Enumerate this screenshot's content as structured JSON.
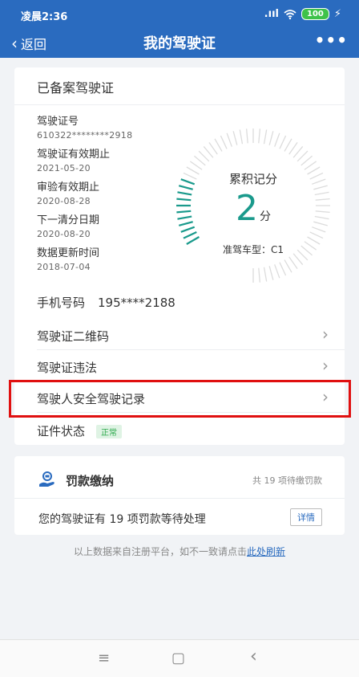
{
  "status_bar": {
    "time": "凌晨2:36",
    "signal": ".ııl",
    "wifi": "wifi-icon",
    "battery": "100",
    "charging": "⚡"
  },
  "nav": {
    "back_label": "返回",
    "title": "我的驾驶证",
    "more": "•••"
  },
  "license_card": {
    "title": "已备案驾驶证",
    "fields": [
      {
        "label": "驾驶证号",
        "value": "610322********2918"
      },
      {
        "label": "驾驶证有效期止",
        "value": "2021-05-20"
      },
      {
        "label": "审验有效期止",
        "value": "2020-08-28"
      },
      {
        "label": "下一清分日期",
        "value": "2020-08-20"
      },
      {
        "label": "数据更新时间",
        "value": "2018-07-04"
      }
    ],
    "gauge": {
      "label": "累积记分",
      "score": "2",
      "unit": "分",
      "max": 12,
      "vehicle_type": "准驾车型：C1"
    },
    "phone": {
      "label": "手机号码",
      "value": "195****2188"
    },
    "rows": [
      {
        "label": "驾驶证二维码"
      },
      {
        "label": "驾驶证违法"
      },
      {
        "label": "驾驶人安全驾驶记录"
      }
    ],
    "status": {
      "label": "证件状态",
      "badge": "正常"
    }
  },
  "fine_card": {
    "title": "罚款缴纳",
    "count_text": "共 19 项待缴罚款",
    "message": "您的驾驶证有 19 项罚款等待处理",
    "detail_button": "详情"
  },
  "footer": {
    "note": "以上数据来自注册平台，如不一致请点击",
    "link": "此处刷新"
  },
  "colors": {
    "primary": "#2a6bbf",
    "accent": "#1a9a8c",
    "highlight": "#e01010",
    "ok": "#2aa84a"
  },
  "system_nav": {
    "menu": "≡",
    "home": "▢",
    "back": "‹"
  }
}
